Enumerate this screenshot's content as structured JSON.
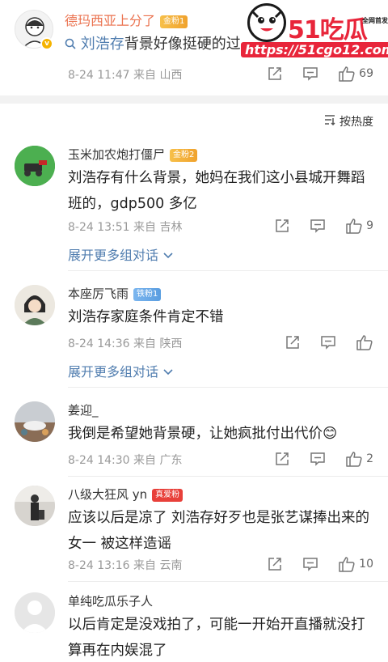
{
  "post": {
    "author": "德玛西亚上分了",
    "badge": "金粉1",
    "text_query": "刘浩存",
    "text_rest": "背景好像挺硬的",
    "text_tail": "过",
    "meta": "8-24 11:47 来自 山西",
    "likes": "69"
  },
  "watermark": {
    "brand": "51吃瓜",
    "tag": "全网首发",
    "url": "https://51cgo12.com"
  },
  "sort": {
    "label": "按热度"
  },
  "comments": [
    {
      "name": "玉米加农炮打僵尸",
      "badge": "金粉2",
      "body": "刘浩存有什么背景，她妈在我们这小县城开舞蹈班的，gdp500 多亿",
      "meta": "8-24 13:51 来自 吉林",
      "likes": "9",
      "expand": "展开更多组对话"
    },
    {
      "name": "本座厉飞雨",
      "badge": "铁粉1",
      "body": "刘浩存家庭条件肯定不错",
      "meta": "8-24 14:36 来自 陕西",
      "likes": "",
      "expand": "展开更多组对话"
    },
    {
      "name": "姜迎_",
      "badge": "",
      "body": "我倒是希望她背景硬，让她疯批付出代价😊",
      "meta": "8-24 14:30 来自 广东",
      "likes": "2"
    },
    {
      "name": "八级大狂风 yn",
      "badge": "真爱粉",
      "body": "应该以后是凉了 刘浩存好歹也是张艺谋捧出来的女一 被这样造谣",
      "meta": "8-24 13:16 来自 云南",
      "likes": "10"
    },
    {
      "name": "单纯吃瓜乐子人",
      "badge": "",
      "body": "以后肯定是没戏拍了，可能一开始开直播就没打算再在内娱混了"
    }
  ],
  "icons": {
    "share": "share-icon",
    "comment": "comment-icon",
    "like": "like-icon",
    "search": "search-icon",
    "sort": "sort-icon",
    "chevron": "chevron-down-icon"
  },
  "colors": {
    "author_orange": "#eb7350",
    "link_blue": "#507daf",
    "meta_gray": "#999999"
  }
}
